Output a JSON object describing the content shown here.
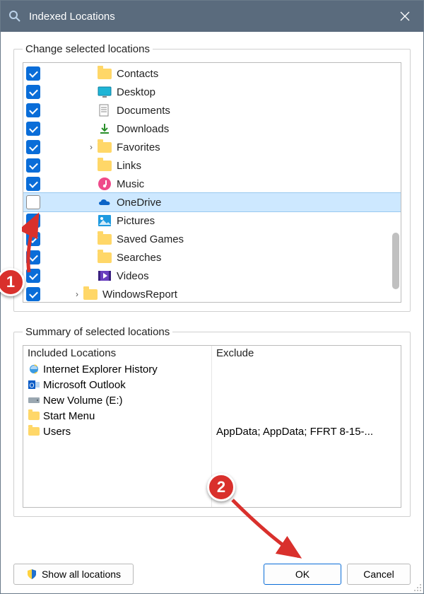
{
  "window": {
    "title": "Indexed Locations"
  },
  "groups": {
    "change": "Change selected locations",
    "summary": "Summary of selected locations"
  },
  "tree": [
    {
      "checked": true,
      "indent": 1,
      "expander": "",
      "icon": "folder",
      "label": "Contacts"
    },
    {
      "checked": true,
      "indent": 1,
      "expander": "",
      "icon": "desktop",
      "label": "Desktop"
    },
    {
      "checked": true,
      "indent": 1,
      "expander": "",
      "icon": "document",
      "label": "Documents"
    },
    {
      "checked": true,
      "indent": 1,
      "expander": "",
      "icon": "download",
      "label": "Downloads"
    },
    {
      "checked": true,
      "indent": 1,
      "expander": ">",
      "icon": "folder",
      "label": "Favorites"
    },
    {
      "checked": true,
      "indent": 1,
      "expander": "",
      "icon": "folder",
      "label": "Links"
    },
    {
      "checked": true,
      "indent": 1,
      "expander": "",
      "icon": "music",
      "label": "Music"
    },
    {
      "checked": false,
      "indent": 1,
      "expander": "",
      "icon": "onedrive",
      "label": "OneDrive",
      "selected": true
    },
    {
      "checked": true,
      "indent": 1,
      "expander": "",
      "icon": "pictures",
      "label": "Pictures"
    },
    {
      "checked": true,
      "indent": 1,
      "expander": "",
      "icon": "folder",
      "label": "Saved Games"
    },
    {
      "checked": true,
      "indent": 1,
      "expander": "",
      "icon": "folder",
      "label": "Searches"
    },
    {
      "checked": true,
      "indent": 1,
      "expander": "",
      "icon": "videos",
      "label": "Videos"
    },
    {
      "checked": true,
      "indent": 0,
      "expander": ">",
      "icon": "folder",
      "label": "WindowsReport"
    }
  ],
  "summary": {
    "left_header": "Included Locations",
    "right_header": "Exclude",
    "rows": [
      {
        "icon": "ie",
        "label": "Internet Explorer History",
        "exclude": ""
      },
      {
        "icon": "outlook",
        "label": "Microsoft Outlook",
        "exclude": ""
      },
      {
        "icon": "drive",
        "label": "New Volume (E:)",
        "exclude": ""
      },
      {
        "icon": "sfolder",
        "label": "Start Menu",
        "exclude": ""
      },
      {
        "icon": "sfolder",
        "label": "Users",
        "exclude": "AppData; AppData; FFRT 8-15-..."
      }
    ]
  },
  "buttons": {
    "show_all": "Show all locations",
    "ok": "OK",
    "cancel": "Cancel"
  },
  "callouts": {
    "one": "1",
    "two": "2"
  }
}
